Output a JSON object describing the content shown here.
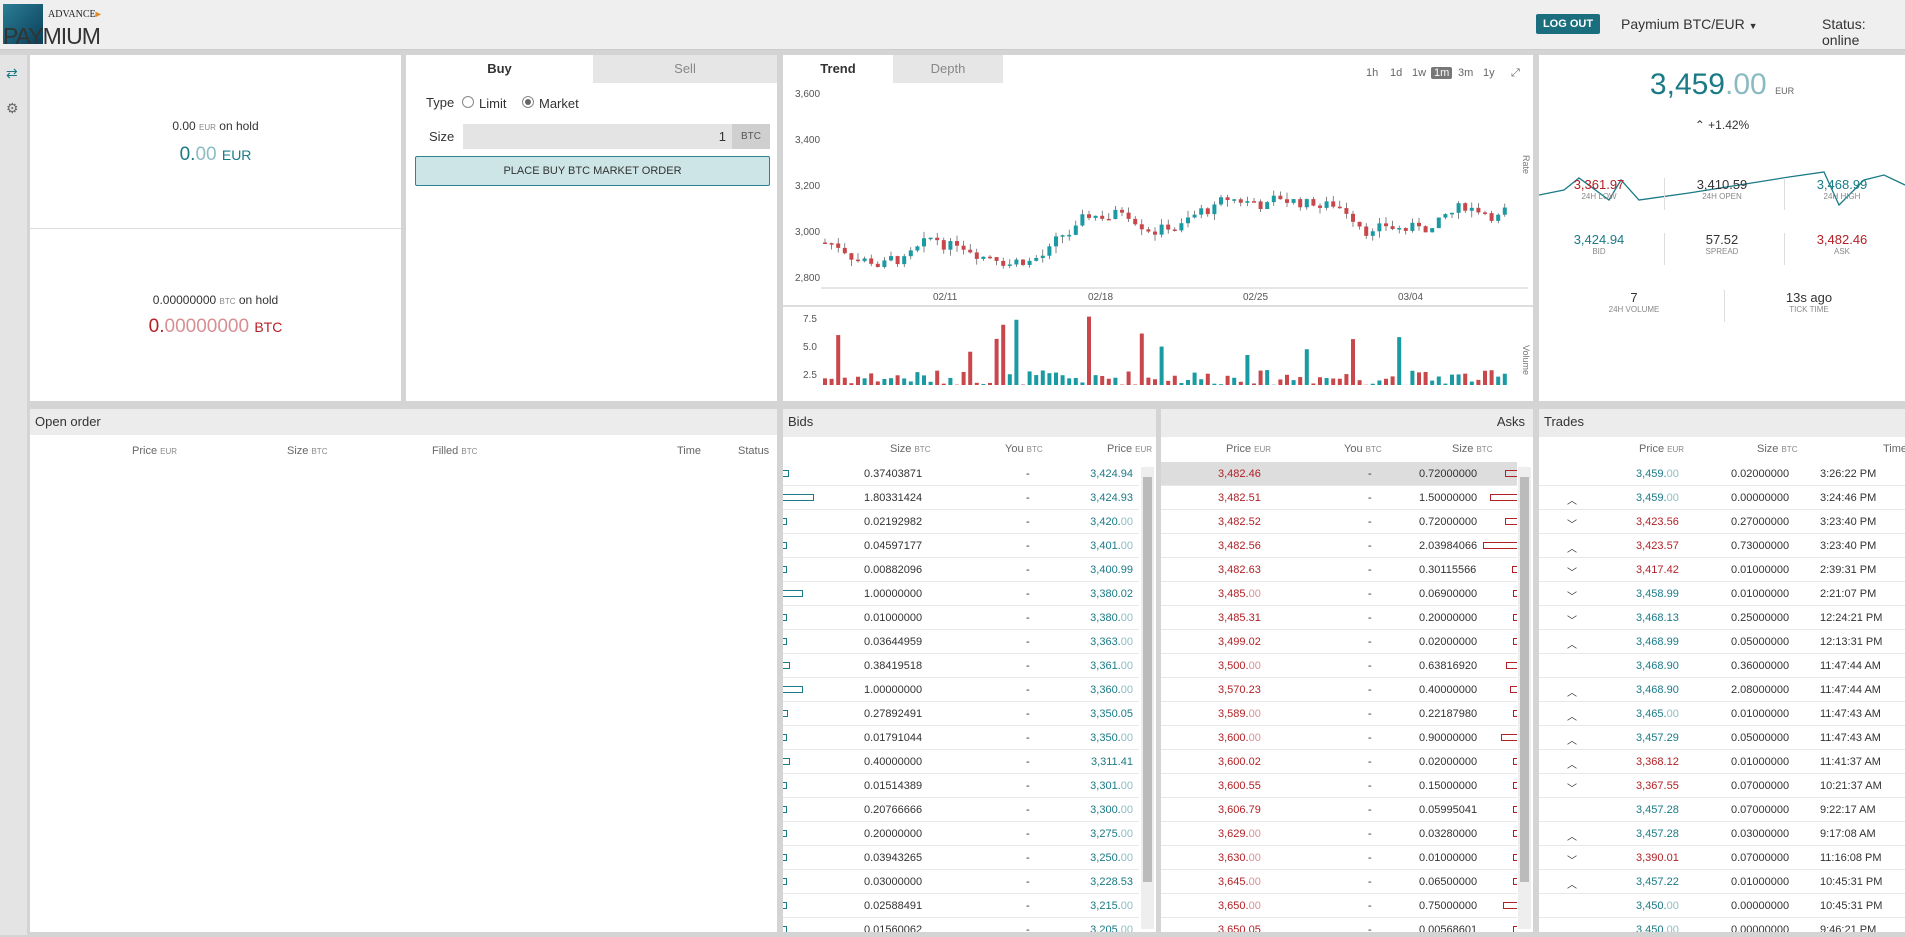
{
  "header": {
    "logo_top": "ADVANCE",
    "logo_word": "PAYMIUM",
    "logout": "LOG OUT",
    "pair": "Paymium BTC/EUR",
    "status": "Status: online"
  },
  "sidebar": {
    "trade_icon": "exchange-icon",
    "settings_icon": "gear-icon"
  },
  "balances": {
    "eur": {
      "hold_value": "0.00",
      "hold_unit": "EUR",
      "hold_label": "on hold",
      "int": "0.",
      "dec": "00",
      "unit": "EUR"
    },
    "btc": {
      "hold_value": "0.00000000",
      "hold_unit": "BTC",
      "hold_label": "on hold",
      "int": "0.",
      "dec": "00000000",
      "unit": "BTC"
    }
  },
  "order_form": {
    "tab_buy": "Buy",
    "tab_sell": "Sell",
    "type_label": "Type",
    "limit": "Limit",
    "market": "Market",
    "selected": "Market",
    "size_label": "Size",
    "size_value": "1",
    "size_unit": "BTC",
    "submit": "PLACE BUY BTC MARKET ORDER"
  },
  "chart": {
    "tab_trend": "Trend",
    "tab_depth": "Depth",
    "ranges": [
      "1h",
      "1d",
      "1w",
      "1m",
      "3m",
      "1y"
    ],
    "active_range": "1m",
    "expand_icon": "expand-icon",
    "price_axis": {
      "ticks": [
        "3,600",
        "3,400",
        "3,200",
        "3,000",
        "2,800"
      ],
      "label": "Rate"
    },
    "volume_axis": {
      "ticks": [
        "7.5",
        "5.0",
        "2.5"
      ],
      "label": "Volume"
    },
    "dates": [
      "02/11",
      "02/18",
      "02/25",
      "03/04"
    ],
    "colors": {
      "up": "#1a9aa3",
      "down": "#c9474b"
    }
  },
  "ticker": {
    "price_int": "3,459",
    "price_dec": ".00",
    "price_unit": "EUR",
    "change": "+1.42%",
    "change_icon": "chevron-up-icon",
    "stats": [
      {
        "value": "3,361.97",
        "label": "24H LOW",
        "color": "red"
      },
      {
        "value": "3,410.59",
        "label": "24H OPEN",
        "color": "dark"
      },
      {
        "value": "3,468.99",
        "label": "24H HIGH",
        "color": "teal"
      },
      {
        "value": "3,424.94",
        "label": "BID",
        "color": "teal"
      },
      {
        "value": "57.52",
        "label": "SPREAD",
        "color": "dark"
      },
      {
        "value": "3,482.46",
        "label": "ASK",
        "color": "red"
      },
      {
        "value": "7",
        "label": "24H VOLUME",
        "color": "dark"
      },
      {
        "value": "13s ago",
        "label": "TICK TIME",
        "color": "dark"
      }
    ]
  },
  "open_orders": {
    "title": "Open order",
    "cols": {
      "price": "Price",
      "price_u": "EUR",
      "size": "Size",
      "size_u": "BTC",
      "filled": "Filled",
      "filled_u": "BTC",
      "time": "Time",
      "status": "Status"
    }
  },
  "bids": {
    "title": "Bids",
    "cols": {
      "size": "Size",
      "size_u": "BTC",
      "you": "You",
      "you_u": "BTC",
      "price": "Price",
      "price_u": "EUR"
    },
    "rows": [
      {
        "size": "0.37403871",
        "you": "-",
        "p": "3,424.",
        "d": "94",
        "bar": 0.19
      },
      {
        "size": "1.80331424",
        "you": "-",
        "p": "3,424.",
        "d": "93",
        "bar": 0.9
      },
      {
        "size": "0.02192982",
        "you": "-",
        "p": "3,420.",
        "d": "00",
        "bar": 0.03
      },
      {
        "size": "0.04597177",
        "you": "-",
        "p": "3,401.",
        "d": "00",
        "bar": 0.03
      },
      {
        "size": "0.00882096",
        "you": "-",
        "p": "3,400.",
        "d": "99",
        "bar": 0.02
      },
      {
        "size": "1.00000000",
        "you": "-",
        "p": "3,380.",
        "d": "02",
        "bar": 0.58
      },
      {
        "size": "0.01000000",
        "you": "-",
        "p": "3,380.",
        "d": "00",
        "bar": 0.02
      },
      {
        "size": "0.03644959",
        "you": "-",
        "p": "3,363.",
        "d": "00",
        "bar": 0.03
      },
      {
        "size": "0.38419518",
        "you": "-",
        "p": "3,361.",
        "d": "00",
        "bar": 0.2
      },
      {
        "size": "1.00000000",
        "you": "-",
        "p": "3,360.",
        "d": "00",
        "bar": 0.58
      },
      {
        "size": "0.27892491",
        "you": "-",
        "p": "3,350.",
        "d": "05",
        "bar": 0.15
      },
      {
        "size": "0.01791044",
        "you": "-",
        "p": "3,350.",
        "d": "00",
        "bar": 0.02
      },
      {
        "size": "0.40000000",
        "you": "-",
        "p": "3,311.",
        "d": "41",
        "bar": 0.2
      },
      {
        "size": "0.01514389",
        "you": "-",
        "p": "3,301.",
        "d": "00",
        "bar": 0.02
      },
      {
        "size": "0.20766666",
        "you": "-",
        "p": "3,300.",
        "d": "00",
        "bar": 0.11
      },
      {
        "size": "0.20000000",
        "you": "-",
        "p": "3,275.",
        "d": "00",
        "bar": 0.11
      },
      {
        "size": "0.03943265",
        "you": "-",
        "p": "3,250.",
        "d": "00",
        "bar": 0.03
      },
      {
        "size": "0.03000000",
        "you": "-",
        "p": "3,228.",
        "d": "53",
        "bar": 0.02
      },
      {
        "size": "0.02588491",
        "you": "-",
        "p": "3,215.",
        "d": "00",
        "bar": 0.02
      },
      {
        "size": "0.01560062",
        "you": "-",
        "p": "3,205.",
        "d": "00",
        "bar": 0.02
      }
    ]
  },
  "asks": {
    "title": "Asks",
    "cols": {
      "price": "Price",
      "price_u": "EUR",
      "you": "You",
      "you_u": "BTC",
      "size": "Size",
      "size_u": "BTC"
    },
    "rows": [
      {
        "p": "3,482.",
        "d": "46",
        "you": "-",
        "size": "0.72000000",
        "bar": 0.36
      },
      {
        "p": "3,482.",
        "d": "51",
        "you": "-",
        "size": "1.50000000",
        "bar": 0.8
      },
      {
        "p": "3,482.",
        "d": "52",
        "you": "-",
        "size": "0.72000000",
        "bar": 0.36
      },
      {
        "p": "3,482.",
        "d": "56",
        "you": "-",
        "size": "2.03984066",
        "bar": 1.0
      },
      {
        "p": "3,482.",
        "d": "63",
        "you": "-",
        "size": "0.30115566",
        "bar": 0.16
      },
      {
        "p": "3,485.",
        "d": "00",
        "you": "-",
        "size": "0.06900000",
        "bar": 0.05
      },
      {
        "p": "3,485.",
        "d": "31",
        "you": "-",
        "size": "0.20000000",
        "bar": 0.1
      },
      {
        "p": "3,499.",
        "d": "02",
        "you": "-",
        "size": "0.02000000",
        "bar": 0.03
      },
      {
        "p": "3,500.",
        "d": "00",
        "you": "-",
        "size": "0.63816920",
        "bar": 0.33
      },
      {
        "p": "3,570.",
        "d": "23",
        "you": "-",
        "size": "0.40000000",
        "bar": 0.2
      },
      {
        "p": "3,589.",
        "d": "00",
        "you": "-",
        "size": "0.22187980",
        "bar": 0.11
      },
      {
        "p": "3,600.",
        "d": "00",
        "you": "-",
        "size": "0.90000000",
        "bar": 0.48
      },
      {
        "p": "3,600.",
        "d": "02",
        "you": "-",
        "size": "0.02000000",
        "bar": 0.03
      },
      {
        "p": "3,600.",
        "d": "55",
        "you": "-",
        "size": "0.15000000",
        "bar": 0.08
      },
      {
        "p": "3,606.",
        "d": "79",
        "you": "-",
        "size": "0.05995041",
        "bar": 0.04
      },
      {
        "p": "3,629.",
        "d": "00",
        "you": "-",
        "size": "0.03280000",
        "bar": 0.03
      },
      {
        "p": "3,630.",
        "d": "00",
        "you": "-",
        "size": "0.01000000",
        "bar": 0.02
      },
      {
        "p": "3,645.",
        "d": "00",
        "you": "-",
        "size": "0.06500000",
        "bar": 0.04
      },
      {
        "p": "3,650.",
        "d": "00",
        "you": "-",
        "size": "0.75000000",
        "bar": 0.4
      },
      {
        "p": "3,650.",
        "d": "05",
        "you": "-",
        "size": "0.00568601",
        "bar": 0.02
      }
    ]
  },
  "trades": {
    "title": "Trades",
    "cols": {
      "price": "Price",
      "price_u": "EUR",
      "size": "Size",
      "size_u": "BTC",
      "time": "Time"
    },
    "rows": [
      {
        "dir": "",
        "p": "3,459.",
        "d": "00",
        "c": "teal",
        "size": "0.02000000",
        "time": "3:26:22 PM"
      },
      {
        "dir": "up",
        "p": "3,459.",
        "d": "00",
        "c": "teal",
        "size": "0.00000000",
        "time": "3:24:46 PM"
      },
      {
        "dir": "down",
        "p": "3,423.",
        "d": "56",
        "c": "red",
        "size": "0.27000000",
        "time": "3:23:40 PM"
      },
      {
        "dir": "up",
        "p": "3,423.",
        "d": "57",
        "c": "red",
        "size": "0.73000000",
        "time": "3:23:40 PM"
      },
      {
        "dir": "down",
        "p": "3,417.",
        "d": "42",
        "c": "red",
        "size": "0.01000000",
        "time": "2:39:31 PM"
      },
      {
        "dir": "down",
        "p": "3,458.",
        "d": "99",
        "c": "teal",
        "size": "0.01000000",
        "time": "2:21:07 PM"
      },
      {
        "dir": "down",
        "p": "3,468.",
        "d": "13",
        "c": "teal",
        "size": "0.25000000",
        "time": "12:24:21 PM"
      },
      {
        "dir": "up",
        "p": "3,468.",
        "d": "99",
        "c": "teal",
        "size": "0.05000000",
        "time": "12:13:31 PM"
      },
      {
        "dir": "",
        "p": "3,468.",
        "d": "90",
        "c": "teal",
        "size": "0.36000000",
        "time": "11:47:44 AM"
      },
      {
        "dir": "up",
        "p": "3,468.",
        "d": "90",
        "c": "teal",
        "size": "2.08000000",
        "time": "11:47:44 AM"
      },
      {
        "dir": "up",
        "p": "3,465.",
        "d": "00",
        "c": "teal",
        "size": "0.01000000",
        "time": "11:47:43 AM"
      },
      {
        "dir": "up",
        "p": "3,457.",
        "d": "29",
        "c": "teal",
        "size": "0.05000000",
        "time": "11:47:43 AM"
      },
      {
        "dir": "up",
        "p": "3,368.",
        "d": "12",
        "c": "red",
        "size": "0.01000000",
        "time": "11:41:37 AM"
      },
      {
        "dir": "down",
        "p": "3,367.",
        "d": "55",
        "c": "red",
        "size": "0.07000000",
        "time": "10:21:37 AM"
      },
      {
        "dir": "",
        "p": "3,457.",
        "d": "28",
        "c": "teal",
        "size": "0.07000000",
        "time": "9:22:17 AM"
      },
      {
        "dir": "up",
        "p": "3,457.",
        "d": "28",
        "c": "teal",
        "size": "0.03000000",
        "time": "9:17:08 AM"
      },
      {
        "dir": "down",
        "p": "3,390.",
        "d": "01",
        "c": "red",
        "size": "0.07000000",
        "time": "11:16:08 PM"
      },
      {
        "dir": "up",
        "p": "3,457.",
        "d": "22",
        "c": "teal",
        "size": "0.01000000",
        "time": "10:45:31 PM"
      },
      {
        "dir": "",
        "p": "3,450.",
        "d": "00",
        "c": "teal",
        "size": "0.00000000",
        "time": "10:45:31 PM"
      },
      {
        "dir": "",
        "p": "3,450.",
        "d": "00",
        "c": "teal",
        "size": "0.00000000",
        "time": "9:46:21 PM"
      }
    ]
  }
}
